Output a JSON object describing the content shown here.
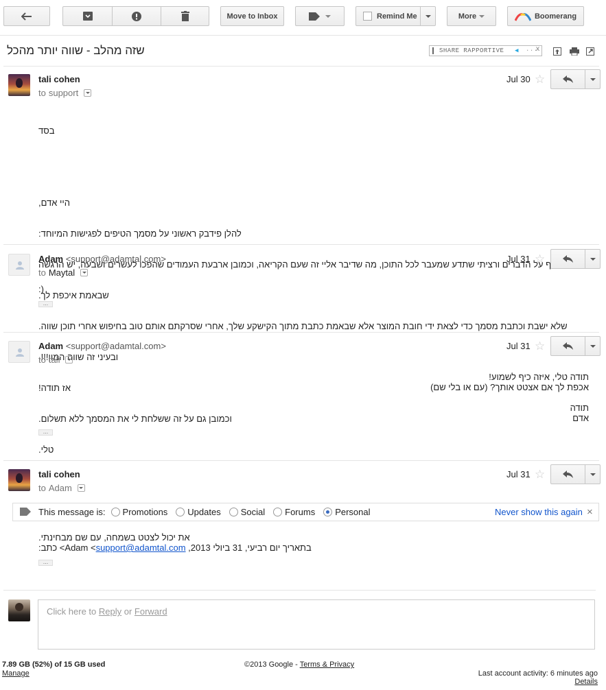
{
  "toolbar": {
    "move_to_inbox": "Move to Inbox",
    "remind_me": "Remind Me",
    "more": "More",
    "boomerang": "Boomerang"
  },
  "subject": "שזה מהלב - שווה יותר מהכל",
  "rapportive": {
    "label": "SHARE RAPPORTIVE",
    "close": "x"
  },
  "messages": [
    {
      "sender": "tali cohen",
      "email": "",
      "to_prefix": "to",
      "to": "support",
      "date": "Jul 30",
      "lines": [
        "בסד",
        "",
        "",
        "היי אדם,",
        "להלן פידבק ראשוני על מסמך הטיפים לפגישות המיוחד:",
        "עברתי ברפרוף על הדברים ורציתי שתדע שמעבר לכל התוכן, מה שדיבר אליי זה שעם הקריאה, וכמובן ארבעת העמודים שהפכו לעשרים ושבעה, יש הרגשה",
        "שבאמת איכפת לך.",
        "שלא ישבת וכתבת מסמך כדי לצאת ידי חובת המוצר אלא שבאמת כתבת מתוך הקישקע שלך, אחרי שסרקתם אותם טוב בחיפוש אחרי תוכן שווה.",
        "ובעיני זה שווה המון!!!.",
        "אז תודה!",
        "וכמובן גם על זה ששלחת לי את המסמך ללא תשלום.",
        "טלי."
      ]
    },
    {
      "sender": "Adam",
      "email": "<support@adamtal.com>",
      "to_prefix": "to",
      "to": "Maytal",
      "date": "Jul 31",
      "lines": [
        ":)"
      ]
    },
    {
      "sender": "Adam",
      "email": "<support@adamtal.com>",
      "to_prefix": "to",
      "to": "tali",
      "date": "Jul 31",
      "lines": [
        "תודה טלי, איזה כיף לשמוע!",
        "אכפת לך אם אצטט אותך? (עם או בלי שם)",
        "",
        "תודה",
        "אדם"
      ]
    },
    {
      "sender": "tali cohen",
      "email": "",
      "to_prefix": "to",
      "to": "Adam",
      "date": "Jul 31",
      "lines": [
        "את יכול לצטט בשמחה, עם שם מבחינתי."
      ],
      "quote_prefix": "בתאריך יום רביעי, 31 ביולי 2013, Adam <",
      "quote_link": "support@adamtal.com",
      "quote_suffix": "> כתב:"
    }
  ],
  "category_bar": {
    "label": "This message is:",
    "options": [
      "Promotions",
      "Updates",
      "Social",
      "Forums",
      "Personal"
    ],
    "selected": "Personal",
    "never_show": "Never show this again",
    "close": "×"
  },
  "reply_box": {
    "prefix": "Click here to ",
    "reply": "Reply",
    "or": " or ",
    "forward": "Forward"
  },
  "footer": {
    "storage": "7.89 GB (52%) of 15 GB used",
    "manage": "Manage",
    "copyright": "©2013 Google - ",
    "terms": "Terms & Privacy",
    "activity": "Last account activity: 6 minutes ago",
    "details": "Details"
  },
  "colors": {
    "link": "#1155cc",
    "accent_radio": "#3a6bbf",
    "star": "#c8c8c8"
  }
}
